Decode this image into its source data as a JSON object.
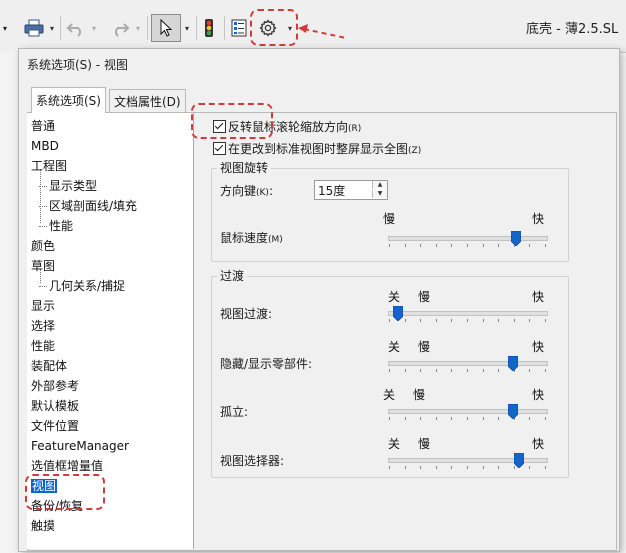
{
  "app": {
    "title": "底壳 - 薄2.5.SL"
  },
  "toolbar": {
    "print_icon": "printer-icon",
    "undo_icon": "undo-icon",
    "redo_icon": "redo-icon",
    "select_icon": "cursor-arrow-icon",
    "traffic_icon": "traffic-light-icon",
    "file_props_icon": "file-properties-icon",
    "options_icon": "gear-icon",
    "dropdown_glyph": "▾"
  },
  "dialog": {
    "title": "系统选项(S) - 视图",
    "tabs": [
      "系统选项(S)",
      "文档属性(D)"
    ]
  },
  "tree": {
    "items": [
      {
        "label": "普通",
        "level": 0
      },
      {
        "label": "MBD",
        "level": 0
      },
      {
        "label": "工程图",
        "level": 0
      },
      {
        "label": "显示类型",
        "level": 1
      },
      {
        "label": "区域剖面线/填充",
        "level": 1
      },
      {
        "label": "性能",
        "level": 1
      },
      {
        "label": "颜色",
        "level": 0
      },
      {
        "label": "草图",
        "level": 0
      },
      {
        "label": "几何关系/捕捉",
        "level": 1
      },
      {
        "label": "显示",
        "level": 0
      },
      {
        "label": "选择",
        "level": 0
      },
      {
        "label": "性能",
        "level": 0
      },
      {
        "label": "装配体",
        "level": 0
      },
      {
        "label": "外部参考",
        "level": 0
      },
      {
        "label": "默认模板",
        "level": 0
      },
      {
        "label": "文件位置",
        "level": 0
      },
      {
        "label": "FeatureManager",
        "level": 0
      },
      {
        "label": "选值框增量值",
        "level": 0
      },
      {
        "label": "视图",
        "level": 0,
        "selected": true
      },
      {
        "label": "备份/恢复",
        "level": 0
      },
      {
        "label": "触摸",
        "level": 0
      }
    ]
  },
  "options": {
    "reverse_wheel": {
      "label": "反转鼠标滚轮缩放方向",
      "hotkey": "(R)",
      "checked": true
    },
    "zoom_to_fit": {
      "label": "在更改到标准视图时整屏显示全图",
      "hotkey": "(Z)",
      "checked": true
    }
  },
  "rotation": {
    "title": "视图旋转",
    "arrow_keys_label": "方向键",
    "arrow_keys_hotkey": "(K)",
    "arrow_keys_value": "15度",
    "mouse_speed_label": "鼠标速度",
    "mouse_speed_hotkey": "(M)",
    "slow": "慢",
    "fast": "快",
    "mouse_speed_level": 0.82
  },
  "transitions": {
    "title": "过渡",
    "off": "关",
    "slow": "慢",
    "fast": "快",
    "sliders": [
      {
        "label": "视图过渡:",
        "level": 0.03
      },
      {
        "label": "隐藏/显示零部件:",
        "level": 0.8
      },
      {
        "label": "孤立:",
        "level": 0.8
      },
      {
        "label": "视图选择器:",
        "level": 0.84
      }
    ]
  },
  "colors": {
    "annotation": "#d23b3b",
    "selection": "#0a64d8",
    "thumb": "#1565c8"
  }
}
